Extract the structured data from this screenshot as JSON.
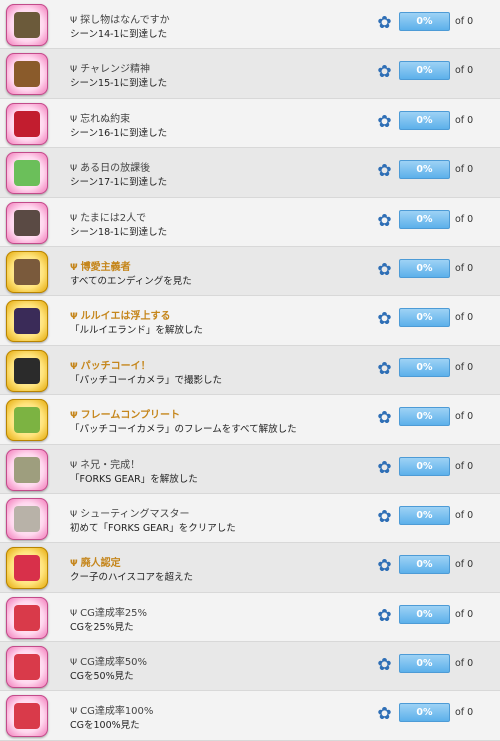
{
  "achievements": [
    {
      "title": "探し物はなんですか",
      "desc": "シーン14-1に到達した",
      "progress": "0%",
      "count": "of 0",
      "icon": "glass-bottle-icon",
      "gold": false,
      "art": "#6b5a3a"
    },
    {
      "title": "チャレンジ精神",
      "desc": "シーン15-1に到達した",
      "progress": "0%",
      "count": "of 0",
      "icon": "cookie-icon",
      "gold": false,
      "art": "#8a5b2b"
    },
    {
      "title": "忘れぬ約束",
      "desc": "シーン16-1に到達した",
      "progress": "0%",
      "count": "of 0",
      "icon": "red-ribbon-icon",
      "gold": false,
      "art": "#c21d2f"
    },
    {
      "title": "ある日の放課後",
      "desc": "シーン17-1に到達した",
      "progress": "0%",
      "count": "of 0",
      "icon": "broom-icon",
      "gold": false,
      "art": "#6bbf5a"
    },
    {
      "title": "たまには2人で",
      "desc": "シーン18-1に到達した",
      "progress": "0%",
      "count": "of 0",
      "icon": "character-portrait-icon",
      "gold": false,
      "art": "#5a4a44"
    },
    {
      "title": "博愛主義者",
      "desc": "すべてのエンディングを見た",
      "progress": "0%",
      "count": "of 0",
      "icon": "character-portrait-icon",
      "gold": true,
      "art": "#7a5a3c"
    },
    {
      "title": "ルルイエは浮上する",
      "desc": "「ルルイエランド」を解放した",
      "progress": "0%",
      "count": "of 0",
      "icon": "city-night-icon",
      "gold": true,
      "art": "#3a2b58"
    },
    {
      "title": "パッチコーイ！",
      "desc": "「パッチコーイカメラ」で撮影した",
      "progress": "0%",
      "count": "of 0",
      "icon": "camera-icon",
      "gold": true,
      "art": "#2b2b2b"
    },
    {
      "title": "フレームコンプリート",
      "desc": "「パッチコーイカメラ」のフレームをすべて解放した",
      "progress": "0%",
      "count": "of 0",
      "icon": "frame-icon",
      "gold": true,
      "art": "#7cb342"
    },
    {
      "title": "ネ兄・完成！",
      "desc": "「FORKS GEAR」を解放した",
      "progress": "0%",
      "count": "of 0",
      "icon": "game-controller-icon",
      "gold": false,
      "art": "#9e9e7e"
    },
    {
      "title": "シューティングマスター",
      "desc": "初めて「FORKS GEAR」をクリアした",
      "progress": "0%",
      "count": "of 0",
      "icon": "character-portrait-icon",
      "gold": false,
      "art": "#b8b2a8"
    },
    {
      "title": "廃人認定",
      "desc": "クー子のハイスコアを超えた",
      "progress": "0%",
      "count": "of 0",
      "icon": "character-portrait-icon",
      "gold": true,
      "art": "#d8304a"
    },
    {
      "title": "CG達成率25%",
      "desc": "CGを25%見た",
      "progress": "0%",
      "count": "of 0",
      "icon": "character-portrait-icon",
      "gold": false,
      "art": "#d93a4a"
    },
    {
      "title": "CG達成率50%",
      "desc": "CGを50%見た",
      "progress": "0%",
      "count": "of 0",
      "icon": "character-portrait-icon",
      "gold": false,
      "art": "#d93a4a"
    },
    {
      "title": "CG達成率100%",
      "desc": "CGを100%見た",
      "progress": "0%",
      "count": "of 0",
      "icon": "character-portrait-icon",
      "gold": false,
      "art": "#d93a4a"
    }
  ],
  "trophy_glyph": "Ψ",
  "gear_glyph": "✿"
}
